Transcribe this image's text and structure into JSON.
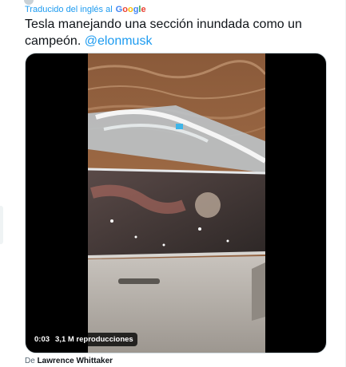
{
  "translation": {
    "label": "Traducido del inglés al",
    "provider": "Google"
  },
  "tweet": {
    "text": "Tesla manejando una sección inundada como un campeón.",
    "mention": "@elonmusk"
  },
  "media": {
    "elapsed": "0:03",
    "views": "3,1 M reproducciones"
  },
  "attribution": {
    "prefix": "De",
    "author": "Lawrence Whittaker"
  },
  "colors": {
    "link": "#1d9bf0",
    "text": "#0f1419",
    "secondary": "#536471"
  },
  "icons": {
    "google_logo": "google-logo"
  }
}
